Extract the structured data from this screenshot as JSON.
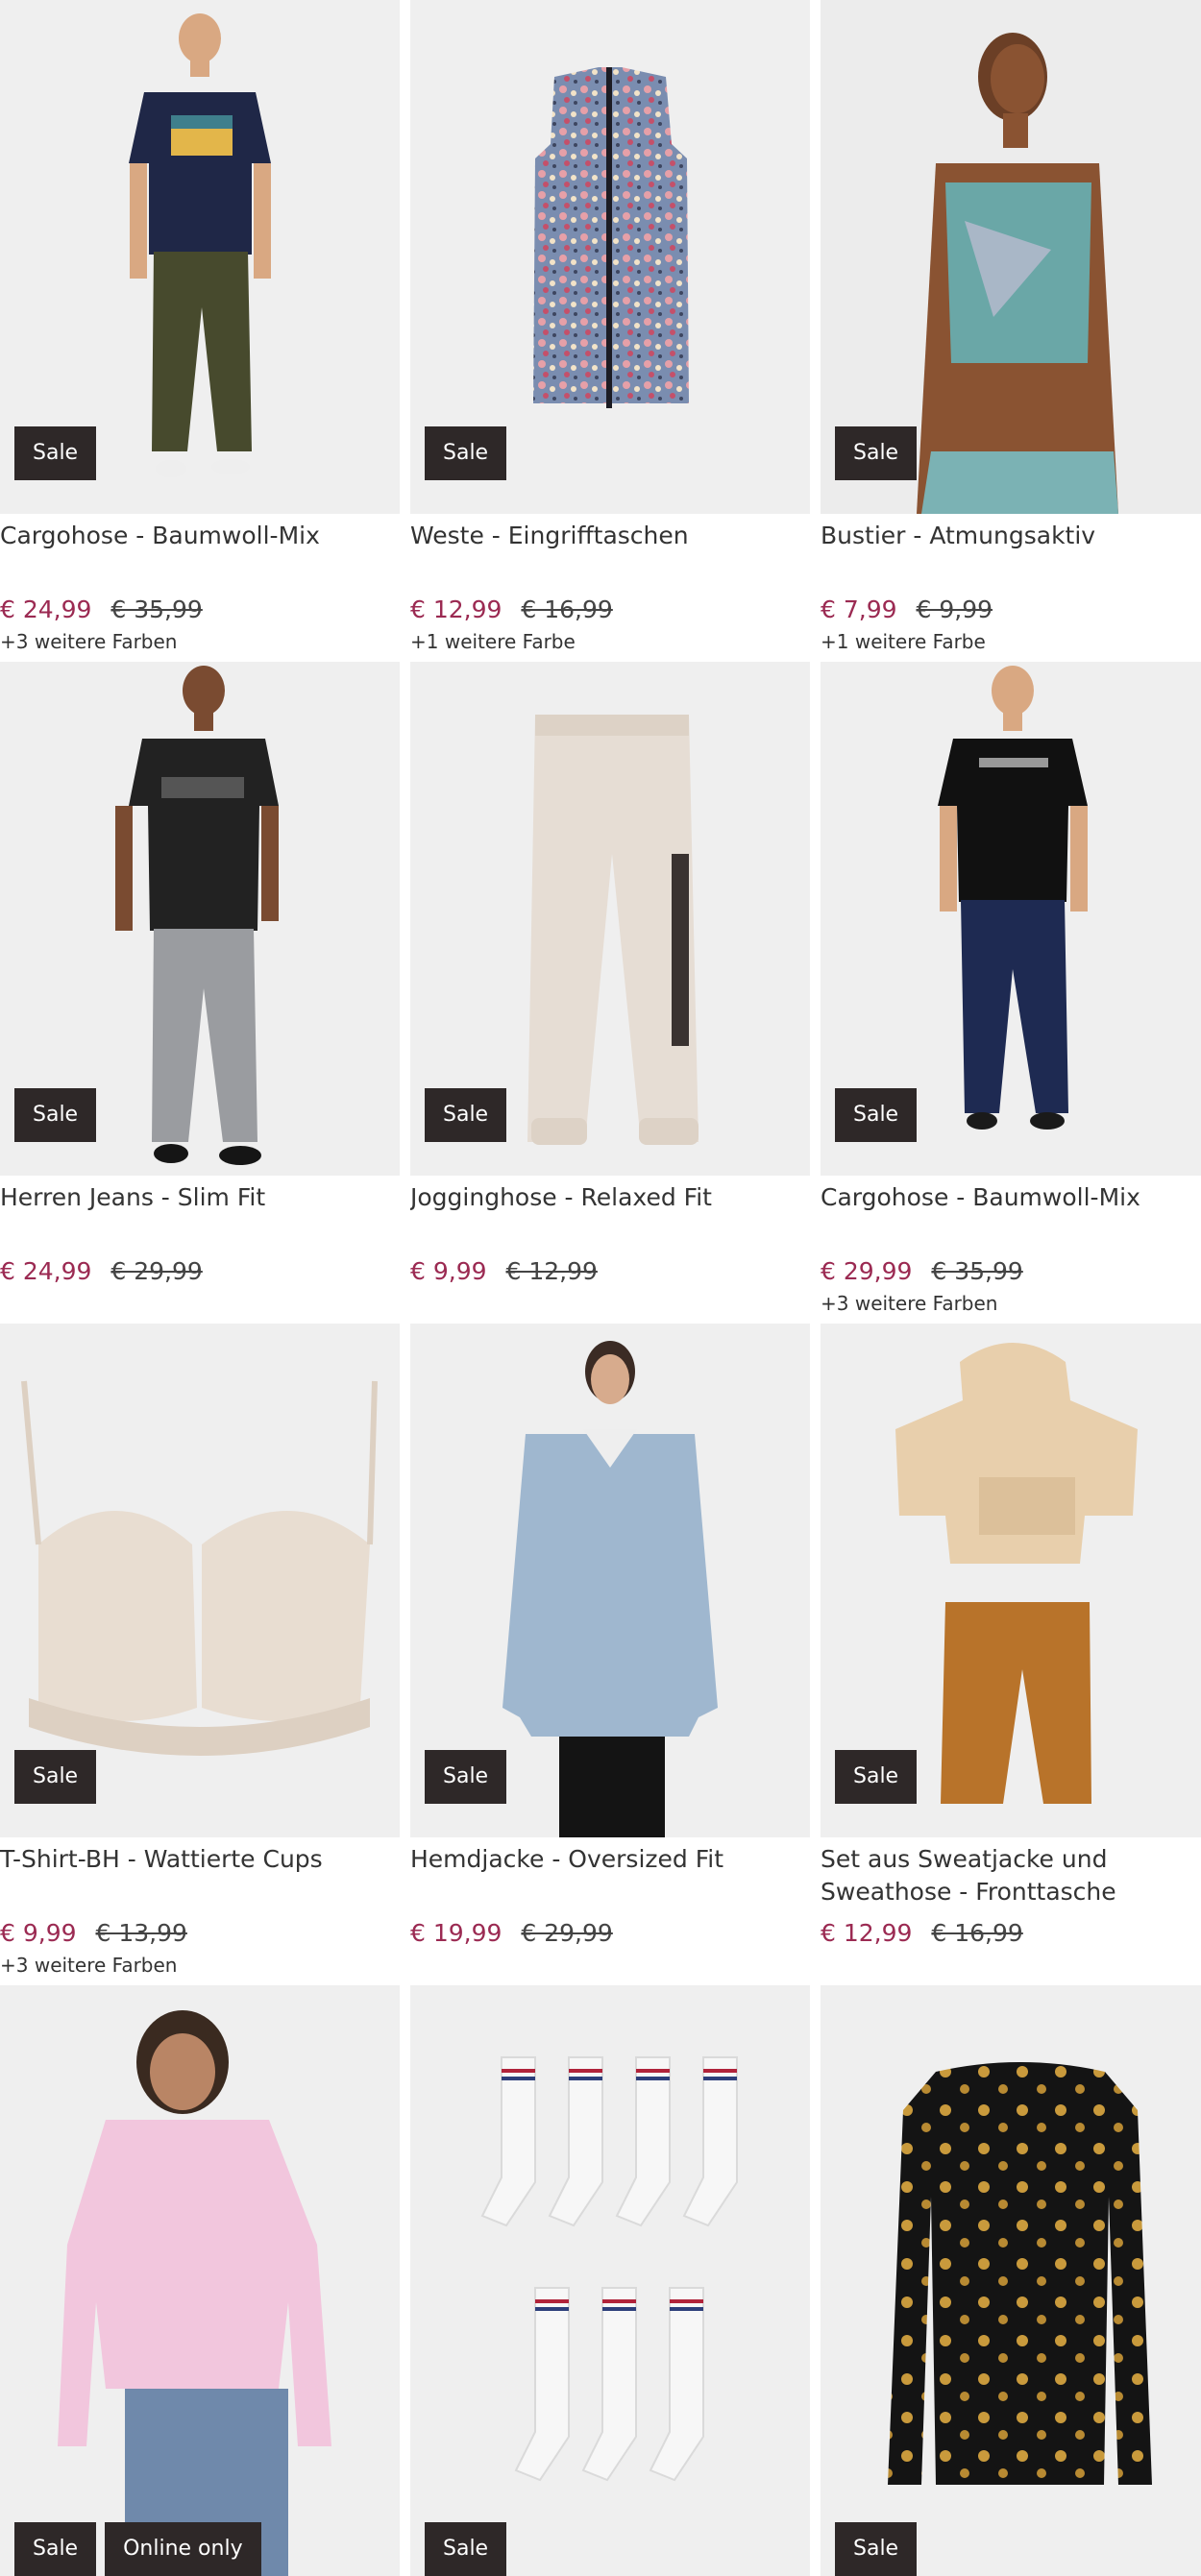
{
  "products": [
    {
      "name": "Cargohose - Baumwoll-Mix",
      "price": "€ 24,99",
      "old_price": "€ 35,99",
      "colors": "+3 weitere Farben",
      "badges": [
        "Sale"
      ],
      "image": "man-tshirt-cargo"
    },
    {
      "name": "Weste - Eingrifftaschen",
      "price": "€ 12,99",
      "old_price": "€ 16,99",
      "colors": "+1 weitere Farbe",
      "badges": [
        "Sale"
      ],
      "image": "floral-vest"
    },
    {
      "name": "Bustier - Atmungsaktiv",
      "price": "€ 7,99",
      "old_price": "€ 9,99",
      "colors": "+1 weitere Farbe",
      "badges": [
        "Sale"
      ],
      "image": "woman-bustier"
    },
    {
      "name": "Herren Jeans - Slim Fit",
      "price": "€ 24,99",
      "old_price": "€ 29,99",
      "colors": "",
      "badges": [
        "Sale"
      ],
      "image": "man-nasa-jeans"
    },
    {
      "name": "Jogginghose - Relaxed Fit",
      "price": "€ 9,99",
      "old_price": "€ 12,99",
      "colors": "",
      "badges": [
        "Sale"
      ],
      "image": "jogging-pants"
    },
    {
      "name": "Cargohose - Baumwoll-Mix",
      "price": "€ 29,99",
      "old_price": "€ 35,99",
      "colors": "+3 weitere Farben",
      "badges": [
        "Sale"
      ],
      "image": "man-black-cargo"
    },
    {
      "name": "T-Shirt-BH - Wattierte Cups",
      "price": "€ 9,99",
      "old_price": "€ 13,99",
      "colors": "+3 weitere Farben",
      "badges": [
        "Sale"
      ],
      "image": "lace-bra"
    },
    {
      "name": "Hemdjacke - Oversized Fit",
      "price": "€ 19,99",
      "old_price": "€ 29,99",
      "colors": "",
      "badges": [
        "Sale"
      ],
      "image": "denim-shirt-jacket"
    },
    {
      "name": "Set aus Sweatjacke und Sweathose - Fronttasche",
      "price": "€ 12,99",
      "old_price": "€ 16,99",
      "colors": "",
      "badges": [
        "Sale"
      ],
      "image": "kids-hoodie-set"
    },
    {
      "name": "",
      "price": "",
      "old_price": "",
      "colors": "",
      "badges": [
        "Sale",
        "Online only"
      ],
      "image": "woman-pink-sweater"
    },
    {
      "name": "",
      "price": "",
      "old_price": "",
      "colors": "",
      "badges": [
        "Sale"
      ],
      "image": "white-socks"
    },
    {
      "name": "",
      "price": "",
      "old_price": "",
      "colors": "",
      "badges": [
        "Sale"
      ],
      "image": "black-floral-top"
    }
  ],
  "colors": {
    "sale_price": "#9b2a52",
    "badge_bg": "#2e2828",
    "tile_bg": "#efefef"
  }
}
